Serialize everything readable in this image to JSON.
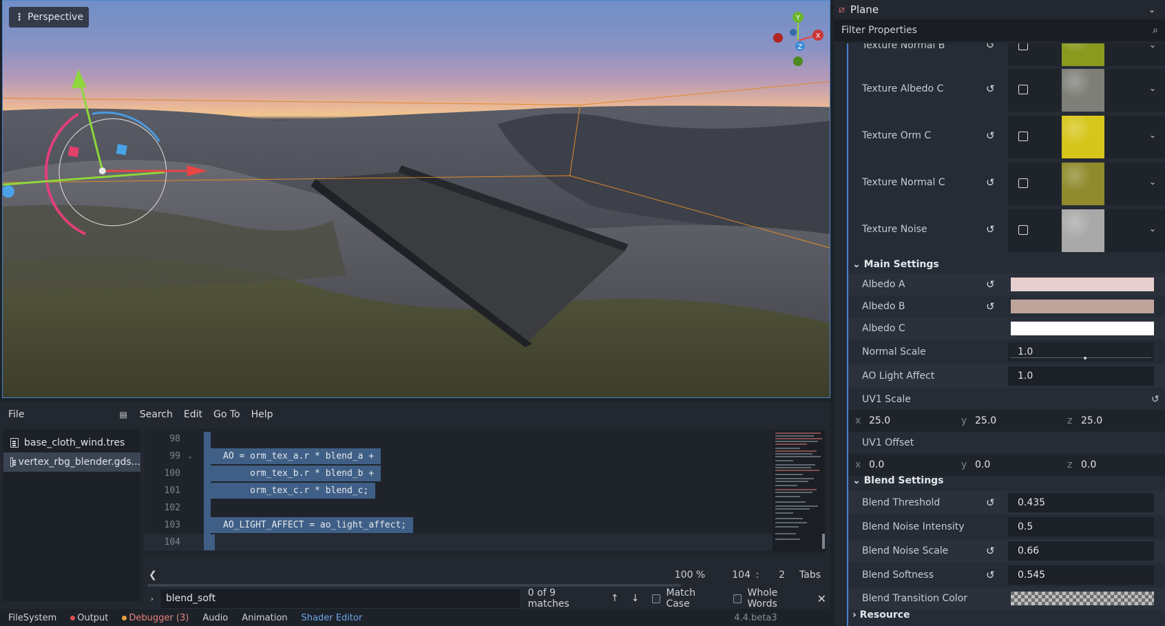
{
  "viewport": {
    "menu_label": "Perspective",
    "gizmo": {
      "x": "X",
      "y": "Y",
      "z": "Z"
    }
  },
  "editor": {
    "menu": [
      "File",
      "Search",
      "Edit",
      "Go To",
      "Help"
    ],
    "files": [
      {
        "name": "base_cloth_wind.tres",
        "selected": false
      },
      {
        "name": "vertex_rbg_blender.gds...",
        "selected": true
      }
    ],
    "lines": [
      {
        "num": "98",
        "code": ""
      },
      {
        "num": "99",
        "code": "AO = orm_tex_a.r * blend_a +",
        "fold": "⌄"
      },
      {
        "num": "100",
        "code": "     orm_tex_b.r * blend_b +"
      },
      {
        "num": "101",
        "code": "     orm_tex_c.r * blend_c;"
      },
      {
        "num": "102",
        "code": ""
      },
      {
        "num": "103",
        "code": "AO_LIGHT_AFFECT = ao_light_affect;"
      },
      {
        "num": "104",
        "code": "}"
      }
    ],
    "status": {
      "zoom": "100 %",
      "line": "104",
      "sep": ":",
      "col": "2",
      "indent": "Tabs"
    },
    "find": {
      "text": "blend_soft",
      "matches": "0 of 9 matches",
      "match_case": "Match Case",
      "whole_words": "Whole Words"
    }
  },
  "bottom_tabs": {
    "filesystem": "FileSystem",
    "output": "Output",
    "debugger": "Debugger (3)",
    "audio": "Audio",
    "animation": "Animation",
    "shader_editor": "Shader Editor",
    "version": "4.4.beta3"
  },
  "inspector": {
    "node_name": "Plane",
    "filter_placeholder": "Filter Properties",
    "textures": [
      {
        "label": "Texture Normal B",
        "color": "#8a9a1e"
      },
      {
        "label": "Texture Albedo C",
        "color": "#7d7f78"
      },
      {
        "label": "Texture Orm C",
        "color": "#d6c51a"
      },
      {
        "label": "Texture Normal C",
        "color": "#8f8a2c"
      },
      {
        "label": "Texture Noise",
        "color": "#a9a9a9"
      }
    ],
    "main_settings": {
      "title": "Main Settings",
      "albedo_a": {
        "label": "Albedo A",
        "color": "#e8cfcf"
      },
      "albedo_b": {
        "label": "Albedo B",
        "color": "#bfa49c"
      },
      "albedo_c": {
        "label": "Albedo C",
        "color": "#ffffff"
      },
      "normal_scale": {
        "label": "Normal Scale",
        "value": "1.0"
      },
      "ao_light_affect": {
        "label": "AO Light Affect",
        "value": "1.0"
      },
      "uv1_scale": {
        "label": "UV1 Scale",
        "x": "25.0",
        "y": "25.0",
        "z": "25.0"
      },
      "uv1_offset": {
        "label": "UV1 Offset",
        "x": "0.0",
        "y": "0.0",
        "z": "0.0"
      },
      "axes": {
        "x": "x",
        "y": "y",
        "z": "z"
      }
    },
    "blend_settings": {
      "title": "Blend Settings",
      "threshold": {
        "label": "Blend Threshold",
        "value": "0.435"
      },
      "noise_intensity": {
        "label": "Blend Noise Intensity",
        "value": "0.5"
      },
      "noise_scale": {
        "label": "Blend Noise Scale",
        "value": "0.66"
      },
      "softness": {
        "label": "Blend Softness",
        "value": "0.545"
      },
      "transition_color": {
        "label": "Blend Transition Color"
      }
    },
    "resource": {
      "title": "Resource"
    }
  },
  "colors": {
    "accent": "#4a7fd0",
    "selection": "#3f5f86"
  }
}
